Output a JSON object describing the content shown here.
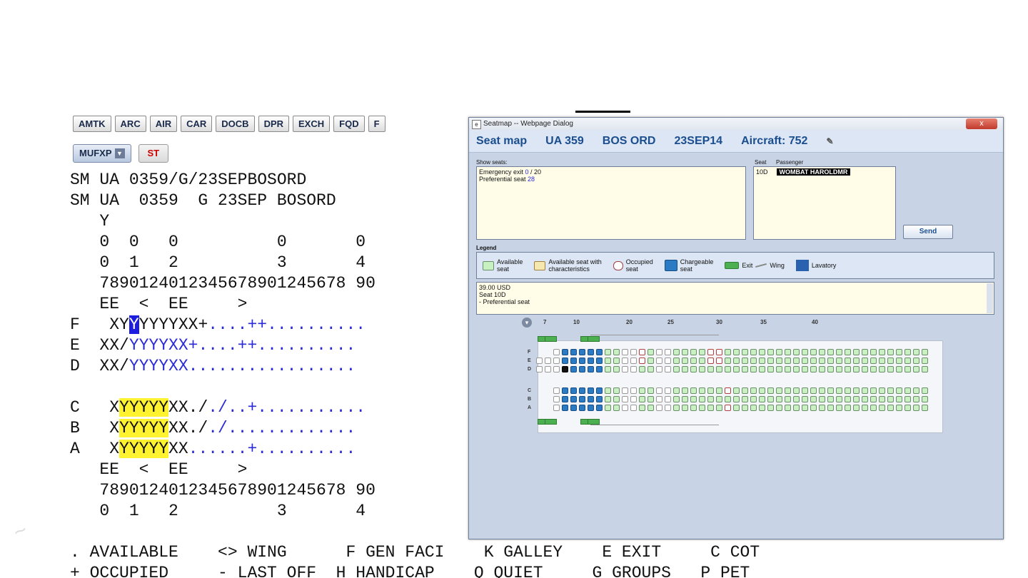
{
  "toolbar": {
    "buttons": [
      "AMTK",
      "ARC",
      "AIR",
      "CAR",
      "DOCB",
      "DPR",
      "EXCH",
      "FQD",
      "F"
    ]
  },
  "row2": {
    "mufxp": "MUFXP",
    "st": "ST"
  },
  "terminal": {
    "l1": "SM UA 0359/G/23SEPBOSORD",
    "l2": "SM UA  0359  G 23SEP BOSORD",
    "l3": "   Y",
    "l4": "   0  0   0          0       0",
    "l5": "   0  1   2          3       4",
    "l6": "   7890124012345678901245678 90",
    "l7": "   EE  <  EE     >",
    "rowF": {
      "a": "F   XY",
      "sel": "Y",
      "b": "YYYYXX+",
      "c": "....++.........."
    },
    "rowE": {
      "a": "E  XX/",
      "b": "YYYYXX",
      "c": "+....++.........."
    },
    "rowD": {
      "a": "D  XX/",
      "b": "YYYYXX",
      "c": "................."
    },
    "rowC": {
      "a": "C   X",
      "hl": "YYYYY",
      "b": "XX./",
      "c": "./..+..........."
    },
    "rowB": {
      "a": "B   X",
      "hl": "YYYYY",
      "b": "XX./",
      "c": "./............."
    },
    "rowA": {
      "a": "A   X",
      "hl": "YYYYY",
      "b": "XX",
      "c": "......+.........."
    },
    "l8": "   EE  <  EE     >",
    "l9": "   7890124012345678901245678 90",
    "l10": "   0  1   2          3       4",
    "leg1": ". AVAILABLE    <> WING      F GEN FACI    K GALLEY    E EXIT     C COT",
    "leg2": "+ OCCUPIED     - LAST OFF  H HANDICAP    Q QUIET     G GROUPS   P PET"
  },
  "dialog": {
    "title": "Seatmap -- Webpage Dialog",
    "close": "x",
    "header": {
      "label": "Seat map",
      "flight": "UA 359",
      "route": "BOS ORD",
      "date": "23SEP14",
      "aircraft": "Aircraft: 752"
    },
    "show_seats_label": "Show seats:",
    "emergency_label": "Emergency exit ",
    "emergency_value": "0",
    "emergency_total": " / 20",
    "preferential_label": "Preferential seat ",
    "preferential_value": "28",
    "seat_col": "Seat",
    "passenger_col": "Passenger",
    "seat_value": "10D",
    "passenger_value": "WOMBAT HAROLDMR",
    "send": "Send",
    "legend_title": "Legend",
    "legend": {
      "available": [
        "Available",
        "seat"
      ],
      "characteristics": [
        "Available seat with",
        "characteristics"
      ],
      "occupied": [
        "Occupied",
        "seat"
      ],
      "chargeable": [
        "Chargeable",
        "seat"
      ],
      "exit": "Exit",
      "wing": "Wing",
      "lavatory": "Lavatory"
    },
    "info": {
      "price": "39.00 USD",
      "seat": "Seat 10D",
      "pref": "- Preferential seat"
    },
    "map": {
      "col_numbers": [
        "7",
        "10",
        "20",
        "25",
        "30",
        "35",
        "40"
      ],
      "row_letters": [
        "F",
        "E",
        "D",
        "C",
        "B",
        "A"
      ]
    }
  }
}
